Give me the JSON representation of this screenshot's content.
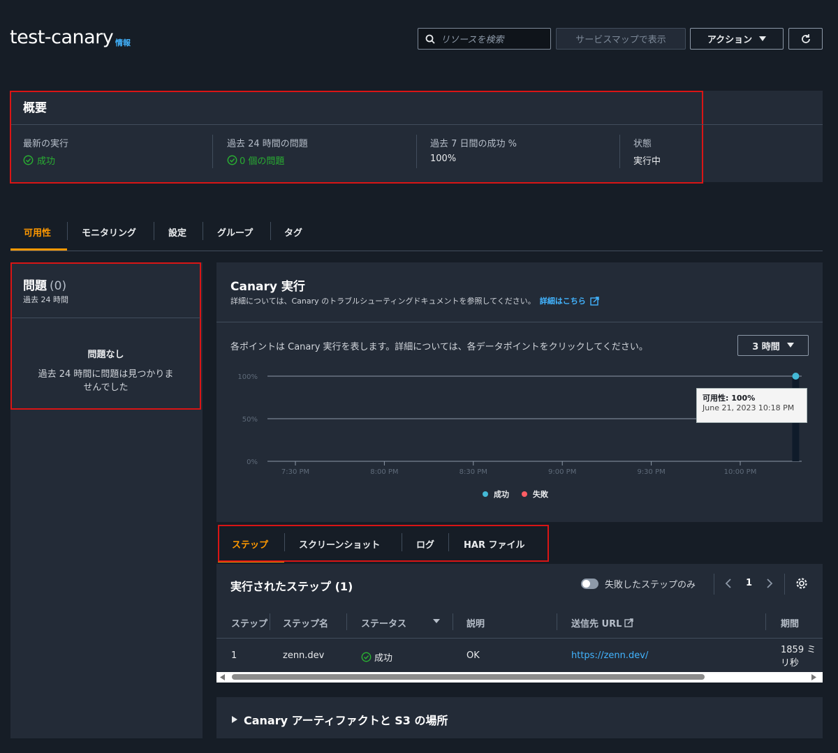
{
  "header": {
    "title": "test-canary",
    "info": "情報",
    "search_placeholder": "リソースを検索",
    "service_map_button": "サービスマップで表示",
    "actions_button": "アクション"
  },
  "overview": {
    "title": "概要",
    "items": [
      {
        "label": "最新の実行",
        "value": "成功"
      },
      {
        "label": "過去 24 時間の問題",
        "value": "0 個の問題"
      },
      {
        "label": "過去 7 日間の成功 %",
        "value": "100%"
      },
      {
        "label": "状態",
        "value": "実行中"
      }
    ]
  },
  "tabs": [
    "可用性",
    "モニタリング",
    "設定",
    "グループ",
    "タグ"
  ],
  "issues": {
    "title": "問題",
    "count": "(0)",
    "subtitle": "過去 24 時間",
    "empty_title": "問題なし",
    "empty_desc_line1": "過去 24 時間に問題は見つかりま",
    "empty_desc_line2": "せんでした"
  },
  "runs": {
    "title": "Canary 実行",
    "desc": "詳細については、Canary のトラブルシューティングドキュメントを参照してください。",
    "learn_more": "詳細はこちら",
    "chart_hint": "各ポイントは Canary 実行を表します。詳細については、各データポイントをクリックしてください。",
    "range_select": "3 時間"
  },
  "chart_data": {
    "type": "scatter",
    "x_ticks": [
      "7:30 PM",
      "8:00 PM",
      "8:30 PM",
      "9:00 PM",
      "9:30 PM",
      "10:00 PM"
    ],
    "y_ticks": [
      "100%",
      "50%",
      "0%"
    ],
    "ylim": [
      0,
      100
    ],
    "series": [
      {
        "name": "成功",
        "color": "#44b9d6",
        "points": [
          {
            "x": "10:18 PM",
            "y": 100
          }
        ]
      },
      {
        "name": "失敗",
        "color": "#ff5d64",
        "points": []
      }
    ],
    "tooltip": {
      "line1": "可用性: 100%",
      "line2": "June 21, 2023 10:18 PM"
    }
  },
  "step_tabs": [
    "ステップ",
    "スクリーンショット",
    "ログ",
    "HAR ファイル"
  ],
  "steps": {
    "title": "実行されたステップ (1)",
    "failed_only": "失敗したステップのみ",
    "page": "1",
    "columns": [
      "ステップ",
      "ステップ名",
      "ステータス",
      "説明",
      "送信先 URL",
      "期間"
    ],
    "rows": [
      {
        "step": "1",
        "name": "zenn.dev",
        "status": "成功",
        "desc": "OK",
        "url": "https://zenn.dev/",
        "duration_line1": "1859 ミ",
        "duration_line2": "リ秒"
      }
    ]
  },
  "artifacts": {
    "title": "Canary アーティファクトと S3 の場所"
  }
}
